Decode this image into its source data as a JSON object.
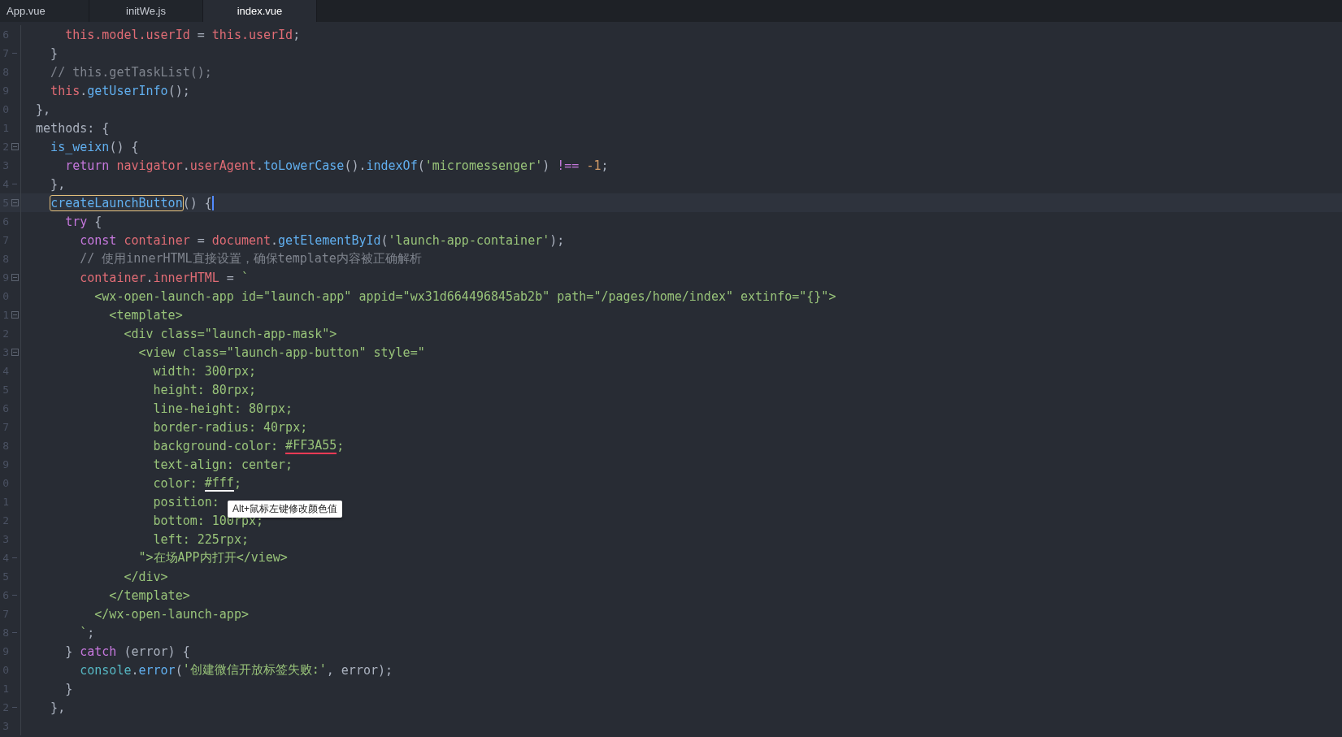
{
  "tabs": [
    {
      "label": "App.vue",
      "selected": false
    },
    {
      "label": "initWe.js",
      "selected": false
    },
    {
      "label": "index.vue",
      "selected": true
    }
  ],
  "editor": {
    "lines": [
      {
        "number": "6",
        "foldable": false,
        "block_end": false,
        "current": false,
        "tokens": [
          {
            "kind": "var",
            "text": "      this.model.userId"
          },
          {
            "kind": "plain",
            "text": " = "
          },
          {
            "kind": "var",
            "text": "this.userId"
          },
          {
            "kind": "plain",
            "text": ";"
          }
        ]
      },
      {
        "number": "7",
        "foldable": false,
        "block_end": true,
        "current": false,
        "tokens": [
          {
            "kind": "plain",
            "text": "    }"
          }
        ]
      },
      {
        "number": "8",
        "foldable": false,
        "block_end": false,
        "current": false,
        "tokens": [
          {
            "kind": "comment",
            "text": "    // this.getTaskList();"
          }
        ]
      },
      {
        "number": "9",
        "foldable": false,
        "block_end": false,
        "current": false,
        "tokens": [
          {
            "kind": "var",
            "text": "    this"
          },
          {
            "kind": "plain",
            "text": "."
          },
          {
            "kind": "func",
            "text": "getUserInfo"
          },
          {
            "kind": "plain",
            "text": "();"
          }
        ]
      },
      {
        "number": "0",
        "foldable": false,
        "block_end": false,
        "current": false,
        "tokens": [
          {
            "kind": "plain",
            "text": "  },"
          }
        ]
      },
      {
        "number": "1",
        "foldable": false,
        "block_end": false,
        "current": false,
        "tokens": [
          {
            "kind": "plain",
            "text": "  methods: {"
          }
        ]
      },
      {
        "number": "2",
        "foldable": true,
        "block_end": false,
        "current": false,
        "tokens": [
          {
            "kind": "func",
            "text": "    is_weixn"
          },
          {
            "kind": "plain",
            "text": "() {"
          }
        ]
      },
      {
        "number": "3",
        "foldable": false,
        "block_end": false,
        "current": false,
        "tokens": [
          {
            "kind": "keyword",
            "text": "      return"
          },
          {
            "kind": "var",
            "text": " navigator"
          },
          {
            "kind": "plain",
            "text": "."
          },
          {
            "kind": "var",
            "text": "userAgent"
          },
          {
            "kind": "plain",
            "text": "."
          },
          {
            "kind": "func",
            "text": "toLowerCase"
          },
          {
            "kind": "plain",
            "text": "()."
          },
          {
            "kind": "func",
            "text": "indexOf"
          },
          {
            "kind": "plain",
            "text": "("
          },
          {
            "kind": "string",
            "text": "'micromessenger'"
          },
          {
            "kind": "plain",
            "text": ") "
          },
          {
            "kind": "keyword",
            "text": "!=="
          },
          {
            "kind": "number",
            "text": " -1"
          },
          {
            "kind": "plain",
            "text": ";"
          }
        ]
      },
      {
        "number": "4",
        "foldable": false,
        "block_end": true,
        "current": false,
        "tokens": [
          {
            "kind": "plain",
            "text": "    },"
          }
        ]
      },
      {
        "number": "5",
        "foldable": true,
        "block_end": false,
        "current": true,
        "tokens": [
          {
            "kind": "func",
            "text": "    createLaunchButton",
            "match": true
          },
          {
            "kind": "plain",
            "text": "() {"
          }
        ]
      },
      {
        "number": "6",
        "foldable": false,
        "block_end": false,
        "current": false,
        "tokens": [
          {
            "kind": "keyword",
            "text": "      try"
          },
          {
            "kind": "plain",
            "text": " {"
          }
        ]
      },
      {
        "number": "7",
        "foldable": false,
        "block_end": false,
        "current": false,
        "tokens": [
          {
            "kind": "keyword",
            "text": "        const"
          },
          {
            "kind": "var",
            "text": " container"
          },
          {
            "kind": "plain",
            "text": " = "
          },
          {
            "kind": "var",
            "text": "document"
          },
          {
            "kind": "plain",
            "text": "."
          },
          {
            "kind": "func",
            "text": "getElementById"
          },
          {
            "kind": "plain",
            "text": "("
          },
          {
            "kind": "string",
            "text": "'launch-app-container'"
          },
          {
            "kind": "plain",
            "text": ");"
          }
        ]
      },
      {
        "number": "8",
        "foldable": false,
        "block_end": false,
        "current": false,
        "tokens": [
          {
            "kind": "comment",
            "text": "        // 使用innerHTML直接设置，确保template内容被正确解析"
          }
        ]
      },
      {
        "number": "9",
        "foldable": true,
        "block_end": false,
        "current": false,
        "tokens": [
          {
            "kind": "var",
            "text": "        container"
          },
          {
            "kind": "plain",
            "text": "."
          },
          {
            "kind": "var",
            "text": "innerHTML"
          },
          {
            "kind": "plain",
            "text": " = "
          },
          {
            "kind": "string",
            "text": "`"
          }
        ]
      },
      {
        "number": "0",
        "foldable": false,
        "block_end": false,
        "current": false,
        "tokens": [
          {
            "kind": "string",
            "text": "          <wx-open-launch-app id=\"launch-app\" appid=\"wx31d664496845ab2b\" path=\"/pages/home/index\" extinfo=\"{}\">"
          }
        ]
      },
      {
        "number": "1",
        "foldable": true,
        "block_end": false,
        "current": false,
        "tokens": [
          {
            "kind": "string",
            "text": "            <template>"
          }
        ]
      },
      {
        "number": "2",
        "foldable": false,
        "block_end": false,
        "current": false,
        "tokens": [
          {
            "kind": "string",
            "text": "              <div class=\"launch-app-mask\">"
          }
        ]
      },
      {
        "number": "3",
        "foldable": true,
        "block_end": false,
        "current": false,
        "tokens": [
          {
            "kind": "string",
            "text": "                <view class=\"launch-app-button\" style=\""
          }
        ]
      },
      {
        "number": "4",
        "foldable": false,
        "block_end": false,
        "current": false,
        "tokens": [
          {
            "kind": "string",
            "text": "                  width: 300rpx;"
          }
        ]
      },
      {
        "number": "5",
        "foldable": false,
        "block_end": false,
        "current": false,
        "tokens": [
          {
            "kind": "string",
            "text": "                  height: 80rpx;"
          }
        ]
      },
      {
        "number": "6",
        "foldable": false,
        "block_end": false,
        "current": false,
        "tokens": [
          {
            "kind": "string",
            "text": "                  line-height: 80rpx;"
          }
        ]
      },
      {
        "number": "7",
        "foldable": false,
        "block_end": false,
        "current": false,
        "tokens": [
          {
            "kind": "string",
            "text": "                  border-radius: 40rpx;"
          }
        ]
      },
      {
        "number": "8",
        "foldable": false,
        "block_end": false,
        "current": false,
        "tokens": [
          {
            "kind": "string",
            "text": "                  background-color: "
          },
          {
            "kind": "string",
            "text": "#FF3A55",
            "color": "#ff3a55"
          },
          {
            "kind": "string",
            "text": ";"
          }
        ]
      },
      {
        "number": "9",
        "foldable": false,
        "block_end": false,
        "current": false,
        "tokens": [
          {
            "kind": "string",
            "text": "                  text-align: center;"
          }
        ]
      },
      {
        "number": "0",
        "foldable": false,
        "block_end": false,
        "current": false,
        "tokens": [
          {
            "kind": "string",
            "text": "                  color: "
          },
          {
            "kind": "string",
            "text": "#fff",
            "color": "#ffffff"
          },
          {
            "kind": "string",
            "text": ";"
          }
        ]
      },
      {
        "number": "1",
        "foldable": false,
        "block_end": false,
        "current": false,
        "tokens": [
          {
            "kind": "string",
            "text": "                  position:"
          }
        ],
        "tooltip": "Alt+鼠标左键修改颜色值"
      },
      {
        "number": "2",
        "foldable": false,
        "block_end": false,
        "current": false,
        "tokens": [
          {
            "kind": "string",
            "text": "                  bottom: 100rpx;"
          }
        ]
      },
      {
        "number": "3",
        "foldable": false,
        "block_end": false,
        "current": false,
        "tokens": [
          {
            "kind": "string",
            "text": "                  left: 225rpx;"
          }
        ]
      },
      {
        "number": "4",
        "foldable": false,
        "block_end": true,
        "current": false,
        "tokens": [
          {
            "kind": "string",
            "text": "                \">在场APP内打开</view>"
          }
        ]
      },
      {
        "number": "5",
        "foldable": false,
        "block_end": false,
        "current": false,
        "tokens": [
          {
            "kind": "string",
            "text": "              </div>"
          }
        ]
      },
      {
        "number": "6",
        "foldable": false,
        "block_end": true,
        "current": false,
        "tokens": [
          {
            "kind": "string",
            "text": "            </template>"
          }
        ]
      },
      {
        "number": "7",
        "foldable": false,
        "block_end": false,
        "current": false,
        "tokens": [
          {
            "kind": "string",
            "text": "          </wx-open-launch-app>"
          }
        ]
      },
      {
        "number": "8",
        "foldable": false,
        "block_end": true,
        "current": false,
        "tokens": [
          {
            "kind": "string",
            "text": "        `"
          },
          {
            "kind": "plain",
            "text": ";"
          }
        ]
      },
      {
        "number": "9",
        "foldable": false,
        "block_end": false,
        "current": false,
        "tokens": [
          {
            "kind": "plain",
            "text": "      } "
          },
          {
            "kind": "keyword",
            "text": "catch"
          },
          {
            "kind": "plain",
            "text": " (error) {"
          }
        ]
      },
      {
        "number": "0",
        "foldable": false,
        "block_end": false,
        "current": false,
        "tokens": [
          {
            "kind": "console",
            "text": "        console"
          },
          {
            "kind": "plain",
            "text": "."
          },
          {
            "kind": "func",
            "text": "error"
          },
          {
            "kind": "plain",
            "text": "("
          },
          {
            "kind": "string",
            "text": "'创建微信开放标签失败:'"
          },
          {
            "kind": "plain",
            "text": ", error);"
          }
        ]
      },
      {
        "number": "1",
        "foldable": false,
        "block_end": false,
        "current": false,
        "tokens": [
          {
            "kind": "plain",
            "text": "      }"
          }
        ]
      },
      {
        "number": "2",
        "foldable": false,
        "block_end": true,
        "current": false,
        "tokens": [
          {
            "kind": "plain",
            "text": "    },"
          }
        ]
      },
      {
        "number": "3",
        "foldable": false,
        "block_end": false,
        "current": false
      }
    ]
  }
}
